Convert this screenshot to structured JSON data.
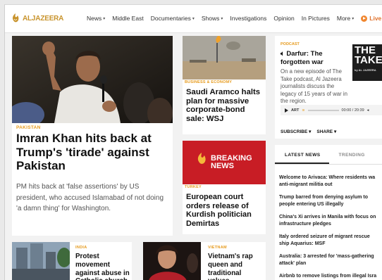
{
  "header": {
    "logo_text": "ALJAZEERA",
    "nav": [
      {
        "label": "News",
        "dropdown": true
      },
      {
        "label": "Middle East",
        "dropdown": false
      },
      {
        "label": "Documentaries",
        "dropdown": true
      },
      {
        "label": "Shows",
        "dropdown": true
      },
      {
        "label": "Investigations",
        "dropdown": false
      },
      {
        "label": "Opinion",
        "dropdown": false
      },
      {
        "label": "In Pictures",
        "dropdown": false
      },
      {
        "label": "More",
        "dropdown": true
      }
    ],
    "live_label": "Live"
  },
  "lead": {
    "kicker": "PAKISTAN",
    "title": "Imran Khan hits back at Trump's 'tirade' against Pakistan",
    "summary": "PM hits back at 'false assertions' by US president, who accused Islamabad of not doing 'a damn thing' for Washington."
  },
  "saudi": {
    "kicker": "BUSINESS & ECONOMY",
    "title": "Saudi Aramco halts plan for massive corporate-bond sale: WSJ"
  },
  "breaking": {
    "banner_line1": "BREAKING",
    "banner_line2": "NEWS",
    "kicker": "TURKEY",
    "title": "European court orders release of Kurdish politician Demirtas"
  },
  "podcast": {
    "label": "PODCAST",
    "title": "Darfur: The forgotten war",
    "description": "On a new episode of The Take podcast, Al Jazeera journalists discuss the legacy of 15 years of war in the region.",
    "thumb_line1": "THE",
    "thumb_line2": "TAKE",
    "thumb_brand": "by AL JAZEERA",
    "player_track": "ART",
    "player_time": "00:00 / 20:39",
    "subscribe": "SUBSCRIBE",
    "share": "SHARE"
  },
  "latest": {
    "tabs": [
      "LATEST NEWS",
      "TRENDING"
    ],
    "items": [
      "Welcome to Arivaca: Where residents wa\nanti-migrant militia out",
      "Trump barred from denying asylum to\npeople entering US illegally",
      "China's Xi arrives in Manila with focus on\ninfrastructure pledges",
      "Italy ordered seizure of migrant rescue\nship Aquarius: MSF",
      "Australia: 3 arrested for 'mass-gathering\nattack' plan",
      "Airbnb to remove listings from illegal Isra\nsettlements"
    ]
  },
  "india": {
    "kicker": "INDIA",
    "title": "Protest movement against abuse in Catholic church"
  },
  "vietnam": {
    "kicker": "VIETNAM",
    "title": "Vietnam's rap queen and traditional values"
  },
  "colors": {
    "accent": "#e69a1c",
    "breaking_red": "#c81d25",
    "live_orange": "#f0862e"
  }
}
